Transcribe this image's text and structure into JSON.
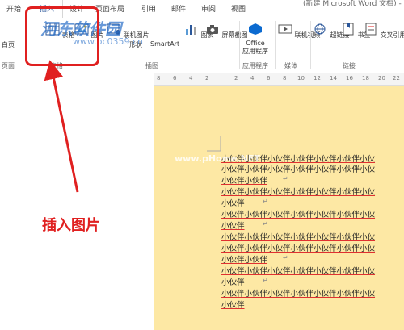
{
  "window": {
    "title": "(新建 Microsoft Word 文档) - Word"
  },
  "tabs": [
    "开始",
    "插入",
    "设计",
    "页面布局",
    "引用",
    "邮件",
    "审阅",
    "视图"
  ],
  "active_tab": "插入",
  "ribbon": {
    "blank_page": "白页",
    "table": "表格",
    "picture": "图片",
    "online_picture": "联机图片",
    "shapes": "形状",
    "smartart": "SmartArt",
    "chart": "图表",
    "screenshot": "屏幕截图",
    "office_apps": "Office\n应用程序",
    "online_video": "联机视频",
    "hyperlink": "超链接",
    "bookmark": "书签",
    "cross_ref": "交叉引用"
  },
  "groups": {
    "pages": "页面",
    "tables": "表格",
    "illustrations": "插图",
    "apps": "应用程序",
    "media": "媒体",
    "links": "链接"
  },
  "ruler_ticks": [
    "8",
    "6",
    "4",
    "2",
    "2",
    "4",
    "6",
    "8",
    "10",
    "12",
    "14",
    "16",
    "18",
    "20",
    "22"
  ],
  "doc_lines": [
    "小伙伴小伙伴小伙伴小伙伴小伙伴小伙伴小伙",
    "小伙伴小伙伴小伙伴小伙伴小伙伴小伙伴小伙",
    "小伙伴小伙伴",
    "小伙伴小伙伴小伙伴小伙伴小伙伴小伙伴小伙",
    "小伙伴",
    "小伙伴小伙伴小伙伴小伙伴小伙伴小伙伴小伙",
    "小伙伴",
    "小伙伴小伙伴小伙伴小伙伴小伙伴小伙伴小伙",
    "小伙伴小伙伴小伙伴小伙伴小伙伴小伙伴小伙",
    "小伙伴小伙伴",
    "小伙伴小伙伴小伙伴小伙伴小伙伴小伙伴小伙",
    "小伙伴",
    "小伙伴小伙伴小伙伴小伙伴小伙伴小伙伴小伙",
    "小伙伴"
  ],
  "annotation": {
    "callout": "插入图片",
    "color": "#e02020"
  },
  "watermarks": {
    "main": "河东软件园",
    "url": "www.pc0359.cn",
    "doc": "www.pHome.NET"
  },
  "colors": {
    "doc_background": "#fde8a4",
    "accent": "#2b579a"
  }
}
